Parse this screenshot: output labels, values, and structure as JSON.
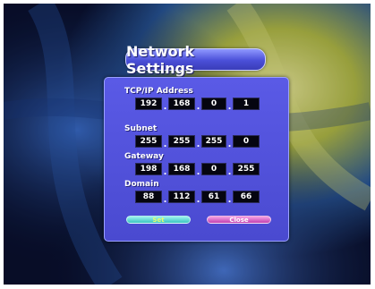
{
  "window": {
    "title": "Network Settings"
  },
  "fields": [
    {
      "label": "TCP/IP Address",
      "octets": [
        "192",
        "168",
        "0",
        "1"
      ]
    },
    {
      "label": "Subnet",
      "octets": [
        "255",
        "255",
        "255",
        "0"
      ]
    },
    {
      "label": "Gateway",
      "octets": [
        "198",
        "168",
        "0",
        "255"
      ]
    },
    {
      "label": "Domain",
      "octets": [
        "88",
        "112",
        "61",
        "66"
      ]
    }
  ],
  "buttons": {
    "set": "Set",
    "close": "Close"
  },
  "colors": {
    "panel": "#4a4ad0",
    "title_bar": "#4a4fd8",
    "set_button": "#3ac4c0",
    "close_button": "#c040b0",
    "octet_box": "#050510"
  }
}
